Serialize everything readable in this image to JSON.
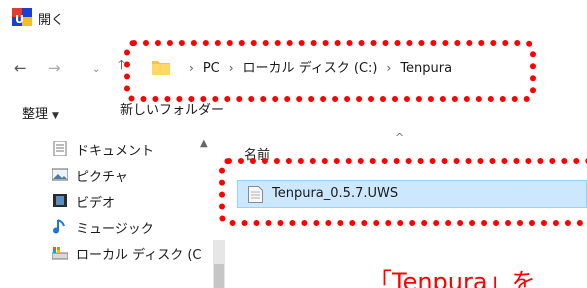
{
  "window": {
    "title": "開く"
  },
  "address": {
    "crumbs": [
      "PC",
      "ローカル ディスク (C:)",
      "Tenpura"
    ],
    "separator": "›"
  },
  "toolbar": {
    "organize_label": "整理",
    "new_folder_label": "新しいフォルダー"
  },
  "sidebar": {
    "items": [
      {
        "label": "ドキュメント",
        "icon": "document-icon"
      },
      {
        "label": "ピクチャ",
        "icon": "picture-icon"
      },
      {
        "label": "ビデオ",
        "icon": "video-icon"
      },
      {
        "label": "ミュージック",
        "icon": "music-icon"
      },
      {
        "label": "ローカル ディスク (C",
        "icon": "drive-icon"
      }
    ]
  },
  "file_list": {
    "column_name": "名前",
    "files": [
      {
        "name": "Tenpura_0.5.7.UWS",
        "selected": true
      }
    ]
  },
  "annotation": {
    "caption": "「Tenpura」を",
    "color": "#ff0000"
  },
  "colors": {
    "selection": "#cce8ff",
    "highlight": "#ff0000"
  }
}
